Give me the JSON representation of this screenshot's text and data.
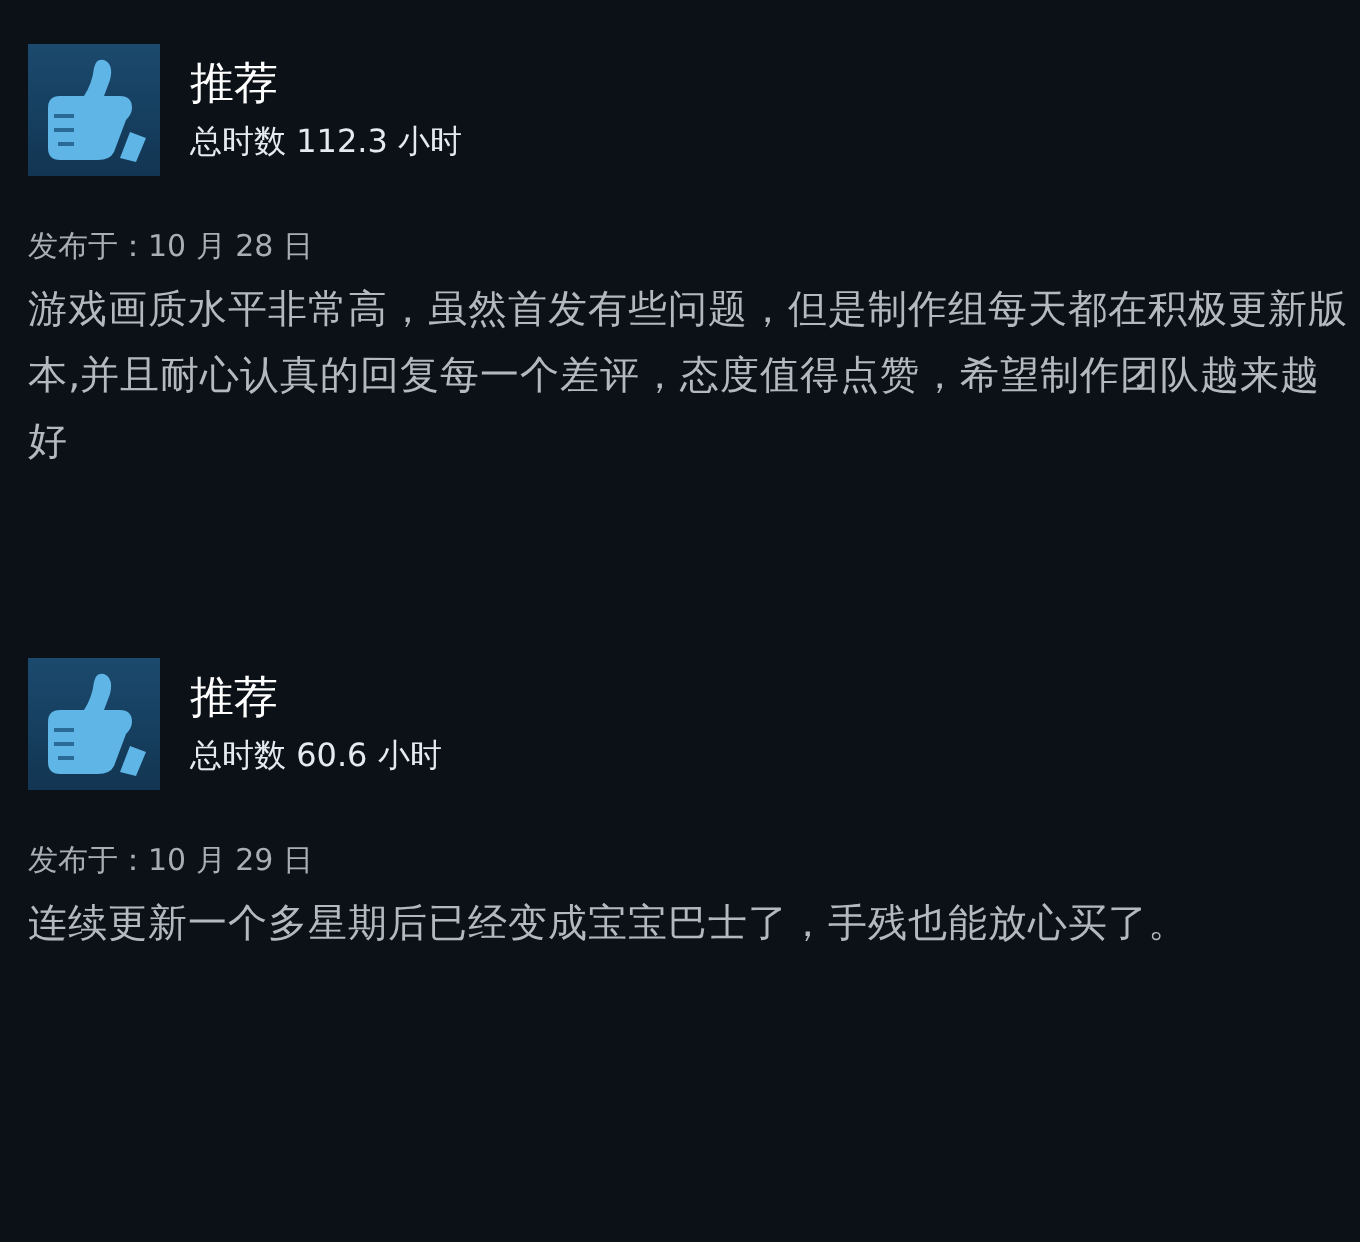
{
  "reviews": [
    {
      "recommended": true,
      "verdict": "推荐",
      "hours": "总时数 112.3 小时",
      "posted": "发布于：10 月 28 日",
      "text": "游戏画质水平非常高，虽然首发有些问题，但是制作组每天都在积极更新版本,并且耐心认真的回复每一个差评，态度值得点赞，希望制作团队越来越好"
    },
    {
      "recommended": true,
      "verdict": "推荐",
      "hours": "总时数 60.6 小时",
      "posted": "发布于：10 月 29 日",
      "text": "连续更新一个多星期后已经变成宝宝巴士了，手残也能放心买了。"
    }
  ]
}
